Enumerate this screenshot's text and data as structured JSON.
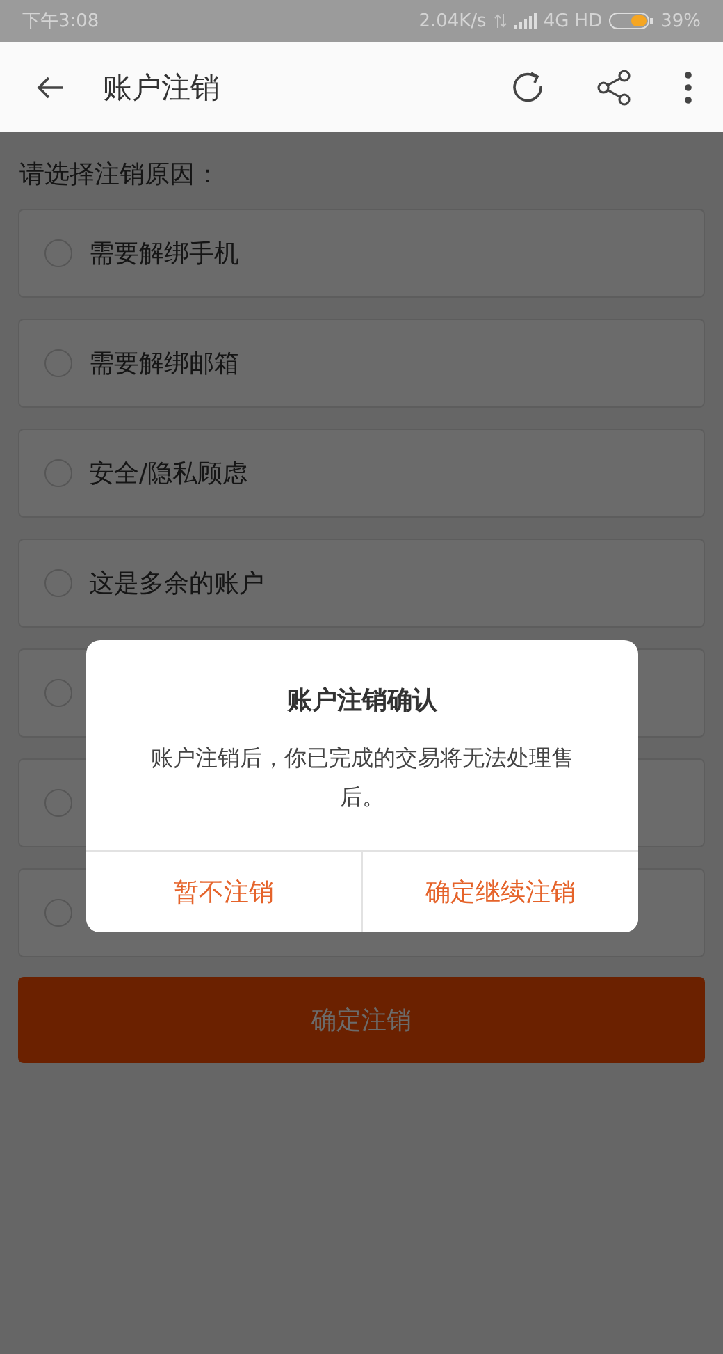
{
  "status_bar": {
    "time": "下午3:08",
    "speed": "2.04K/s",
    "network": "4G HD",
    "battery": "39%"
  },
  "app_bar": {
    "title": "账户注销"
  },
  "prompt": "请选择注销原因：",
  "options": [
    {
      "label": "需要解绑手机",
      "selected": false
    },
    {
      "label": "需要解绑邮箱",
      "selected": false
    },
    {
      "label": "安全/隐私顾虑",
      "selected": false
    },
    {
      "label": "这是多余的账户",
      "selected": false
    },
    {
      "selected": false
    },
    {
      "selected": false
    },
    {
      "selected": false
    }
  ],
  "submit_button": "确定注销",
  "dialog": {
    "title": "账户注销确认",
    "message": "账户注销后，你已完成的交易将无法处理售后。",
    "buttons": [
      "暂不注销",
      "确定继续注销"
    ]
  }
}
